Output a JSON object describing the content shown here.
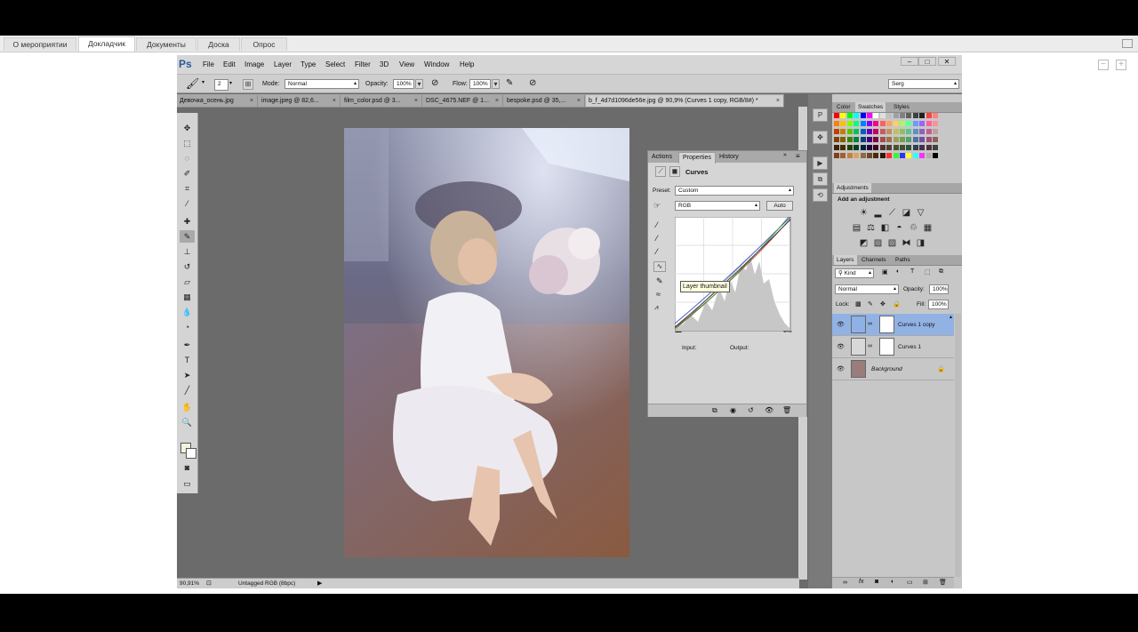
{
  "webinar": {
    "tabs": [
      "О мероприятии",
      "Докладчик",
      "Документы",
      "Доска",
      "Опрос"
    ],
    "active_tab": "Докладчик"
  },
  "photoshop": {
    "logo": "Ps",
    "menu": [
      "File",
      "Edit",
      "Image",
      "Layer",
      "Type",
      "Select",
      "Filter",
      "3D",
      "View",
      "Window",
      "Help"
    ],
    "options": {
      "brush_size": "2",
      "mode_label": "Mode:",
      "mode_value": "Normal",
      "opacity_label": "Opacity:",
      "opacity_value": "100%",
      "flow_label": "Flow:",
      "flow_value": "100%",
      "workspace": "Serg"
    },
    "doc_tabs": [
      "Девочка_осень.jpg",
      "image.jpeg @ 82,6...",
      "film_color.psd @ 3...",
      "DSC_4675.NEF @ 1...",
      "bespoke.psd @ 35,...",
      "b_f_4d7d1096de56e.jpg @ 90,9% (Curves 1 copy, RGB/8#) *"
    ],
    "status": {
      "zoom": "90,91%",
      "profile": "Untagged RGB (8bpc)"
    },
    "properties": {
      "tabs": [
        "Actions",
        "Properties",
        "History"
      ],
      "active_tab": "Properties",
      "title": "Curves",
      "preset_label": "Preset:",
      "preset_value": "Custom",
      "channel_value": "RGB",
      "auto_label": "Auto",
      "input_label": "Input:",
      "output_label": "Output:"
    },
    "color_panel": {
      "tabs": [
        "Color",
        "Swatches",
        "Styles"
      ],
      "active_tab": "Swatches"
    },
    "adjustments": {
      "tab": "Adjustments",
      "heading": "Add an adjustment"
    },
    "layers": {
      "tabs": [
        "Layers",
        "Channels",
        "Paths"
      ],
      "active_tab": "Layers",
      "filter_value": "Kind",
      "blend_value": "Normal",
      "opacity_label": "Opacity:",
      "opacity_value": "100%",
      "lock_label": "Lock:",
      "fill_label": "Fill:",
      "fill_value": "100%",
      "items": [
        {
          "name": "Curves 1 copy",
          "selected": true
        },
        {
          "name": "Curves 1",
          "selected": false
        },
        {
          "name": "Background",
          "selected": false
        }
      ],
      "tooltip": "Layer thumbnail"
    }
  }
}
